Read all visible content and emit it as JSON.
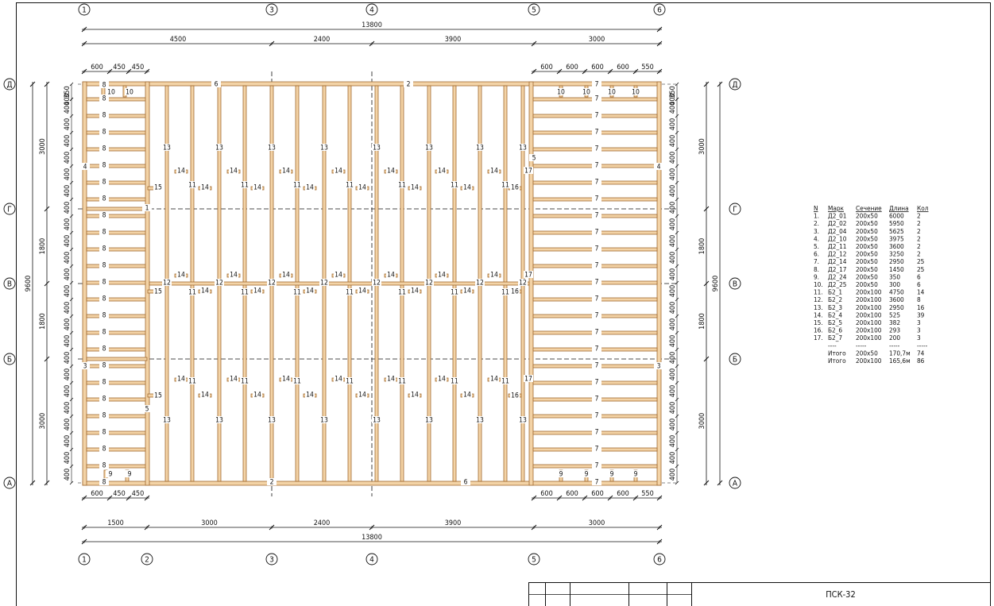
{
  "drawing": {
    "code": "ПСК-32",
    "axes_x": [
      "1",
      "2",
      "3",
      "4",
      "5",
      "6"
    ],
    "axes_y": [
      "А",
      "Б",
      "В",
      "Г",
      "Д"
    ],
    "overall_width": "13800",
    "overall_height": "9600",
    "top_spans": [
      "4500",
      "2400",
      "3900",
      "3000"
    ],
    "bottom_spans": [
      "1500",
      "3000",
      "2400",
      "3900",
      "3000"
    ],
    "left_spans": [
      "3000",
      "1800",
      "1800",
      "3000"
    ],
    "left_small_top": [
      "600",
      "450",
      "450"
    ],
    "left_small_bottom": [
      "600",
      "450",
      "450"
    ],
    "right_small_top": [
      "600",
      "600",
      "600",
      "600",
      "550"
    ],
    "right_small_bottom": [
      "600",
      "600",
      "600",
      "600",
      "550"
    ],
    "joist_spacing_top": "350",
    "joist_spacing": "400"
  },
  "marks": {
    "m1": "1",
    "m2": "2",
    "m3": "3",
    "m4": "4",
    "m5": "5",
    "m6": "6",
    "m7": "7",
    "m8": "8",
    "m9": "9",
    "m10": "10",
    "m11": "11",
    "m12": "12",
    "m13": "13",
    "m14": "14",
    "m15": "15",
    "m16": "16",
    "m17": "17"
  },
  "spec": {
    "headers": [
      "N",
      "Марк",
      "Сечение",
      "Длина",
      "Кол"
    ],
    "rows": [
      [
        "1.",
        "Д2_01",
        "200х50",
        "6000",
        "2"
      ],
      [
        "2.",
        "Д2_02",
        "200х50",
        "5950",
        "2"
      ],
      [
        "3.",
        "Д2_04",
        "200х50",
        "5625",
        "2"
      ],
      [
        "4.",
        "Д2_10",
        "200х50",
        "3975",
        "2"
      ],
      [
        "5.",
        "Д2_11",
        "200х50",
        "3600",
        "2"
      ],
      [
        "6.",
        "Д2_12",
        "200х50",
        "3250",
        "2"
      ],
      [
        "7.",
        "Д2_14",
        "200х50",
        "2950",
        "25"
      ],
      [
        "8.",
        "Д2_17",
        "200х50",
        "1450",
        "25"
      ],
      [
        "9.",
        "Д2_24",
        "200х50",
        "350",
        "6"
      ],
      [
        "10.",
        "Д2_25",
        "200х50",
        "300",
        "6"
      ],
      [
        "11.",
        "Б2_1",
        "200х100",
        "4750",
        "14"
      ],
      [
        "12.",
        "Б2_2",
        "200х100",
        "3600",
        "8"
      ],
      [
        "13.",
        "Б2_3",
        "200х100",
        "2950",
        "16"
      ],
      [
        "14.",
        "Б2_4",
        "200х100",
        "525",
        "39"
      ],
      [
        "15.",
        "Б2_5",
        "200х100",
        "382",
        "3"
      ],
      [
        "16.",
        "Б2_6",
        "200х100",
        "293",
        "3"
      ],
      [
        "17.",
        "Б2_7",
        "200х100",
        "200",
        "3"
      ]
    ],
    "sep": [
      "----",
      "-----",
      "-----",
      "-----"
    ],
    "totals": [
      [
        "Итого",
        "200х50",
        "170,7м",
        "74"
      ],
      [
        "Итого",
        "200х100",
        "165,6м",
        "86"
      ]
    ]
  },
  "colors": {
    "timber_fill": "#f3d3a6",
    "timber_edge": "#a06a30",
    "line": "#111111"
  }
}
